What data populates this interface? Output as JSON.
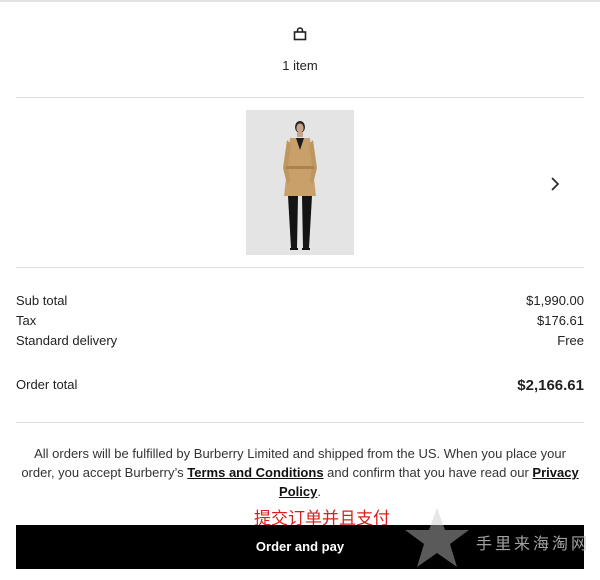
{
  "cart": {
    "item_count": "1 item"
  },
  "product": {
    "image_alt": "Trench coat product image"
  },
  "summary": {
    "subtotal_label": "Sub total",
    "subtotal_value": "$1,990.00",
    "tax_label": "Tax",
    "tax_value": "$176.61",
    "delivery_label": "Standard delivery",
    "delivery_value": "Free",
    "total_label": "Order total",
    "total_value": "$2,166.61"
  },
  "disclaimer": {
    "text_1": "All orders will be fulfilled by Burberry Limited and shipped from the US. When you place your order, you accept Burberry’s ",
    "terms_link": "Terms and Conditions",
    "text_2": " and confirm that you have read our ",
    "privacy_link": "Privacy Policy",
    "text_3": "."
  },
  "annotation": {
    "text": "提交订单并且支付"
  },
  "button": {
    "order_label": "Order and pay"
  },
  "watermark": {
    "text": "手里来海淘网"
  },
  "icons": {
    "bag": "shopping-bag-icon",
    "next": "chevron-right-icon"
  },
  "colors": {
    "button_bg": "#000000",
    "annotation": "#d8201d",
    "divider": "#dedede"
  }
}
